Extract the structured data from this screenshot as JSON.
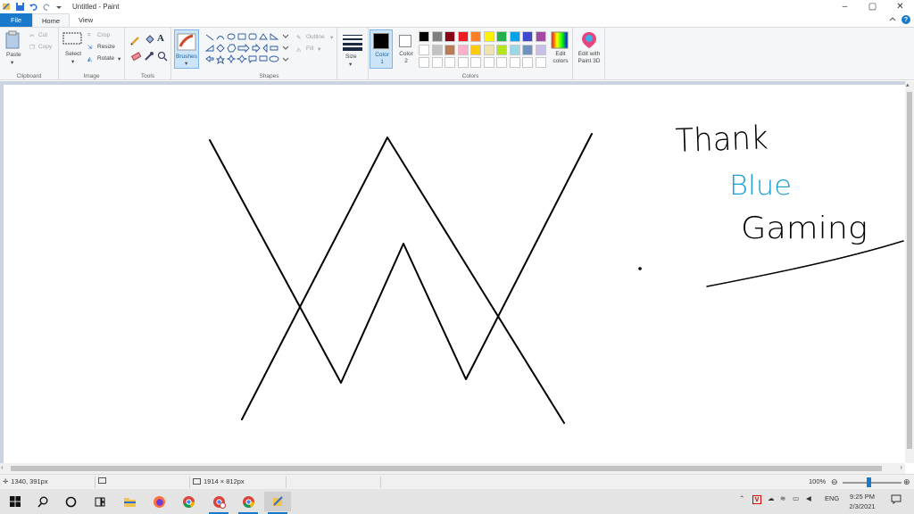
{
  "window": {
    "title": "Untitled - Paint",
    "controls": {
      "minimize": "–",
      "maximize": "▢",
      "close": "✕"
    }
  },
  "tabs": [
    {
      "label": "File"
    },
    {
      "label": "Home"
    },
    {
      "label": "View"
    }
  ],
  "ribbon": {
    "clipboard": {
      "group_label": "Clipboard",
      "paste": "Paste",
      "cut": "Cut",
      "copy": "Copy"
    },
    "image": {
      "group_label": "Image",
      "select": "Select",
      "crop": "Crop",
      "resize": "Resize",
      "rotate": "Rotate"
    },
    "tools": {
      "group_label": "Tools"
    },
    "brushes": {
      "label": "Brushes"
    },
    "shapes": {
      "group_label": "Shapes",
      "outline": "Outline",
      "fill": "Fill"
    },
    "size": {
      "label": "Size"
    },
    "colors": {
      "group_label": "Colors",
      "color1_label": "Color 1",
      "color2_label": "Color 2",
      "edit_colors": "Edit colors",
      "edit_paint3d": "Edit with Paint 3D",
      "color1": "#000000",
      "color2": "#ffffff",
      "palette_row1": [
        "#000000",
        "#7f7f7f",
        "#880015",
        "#ed1c24",
        "#ff7f27",
        "#fff200",
        "#22b14c",
        "#00a2e8",
        "#3f48cc",
        "#a349a4"
      ],
      "palette_row2": [
        "#ffffff",
        "#c3c3c3",
        "#b97a57",
        "#ffaec9",
        "#ffc90e",
        "#efe4b0",
        "#b5e61d",
        "#99d9ea",
        "#7092be",
        "#c8bfe7"
      ],
      "palette_row3": [
        "#ffffff",
        "#ffffff",
        "#ffffff",
        "#ffffff",
        "#ffffff",
        "#ffffff",
        "#ffffff",
        "#ffffff",
        "#ffffff",
        "#ffffff"
      ]
    }
  },
  "canvas": {
    "handwriting": {
      "line1": "Thank",
      "line2": "Blue",
      "line3": "Gaming"
    },
    "ink_colors": {
      "black": "#000000",
      "blue": "#1a9fd9"
    }
  },
  "status": {
    "cursor_pos": "1340, 391px",
    "canvas_size": "1914 × 812px",
    "zoom": "100%"
  },
  "taskbar": {
    "language": "ENG",
    "time": "9:25 PM",
    "date": "2/3/2021"
  }
}
